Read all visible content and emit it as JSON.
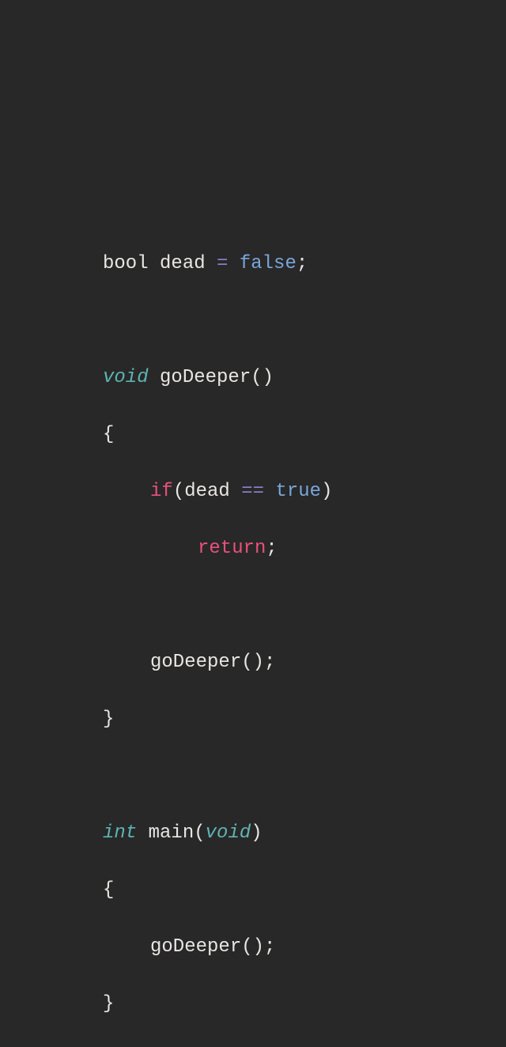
{
  "code": {
    "line1": {
      "type": "bool",
      "ident": " dead ",
      "op": "=",
      "bool": " false",
      "semi": ";"
    },
    "line3": {
      "type": "void",
      "ident": " goDeeper",
      "parens": "()"
    },
    "line4": "{",
    "line5": {
      "kw": "if",
      "open": "(",
      "ident": "dead ",
      "op": "==",
      "bool": " true",
      "close": ")"
    },
    "line6": {
      "kw": "return",
      "semi": ";"
    },
    "line8": {
      "call": "goDeeper();"
    },
    "line9": "}",
    "line11": {
      "type": "int",
      "ident": " main(",
      "param": "void",
      "close": ")"
    },
    "line12": "{",
    "line13": {
      "call": "goDeeper();"
    },
    "line14": "}"
  }
}
